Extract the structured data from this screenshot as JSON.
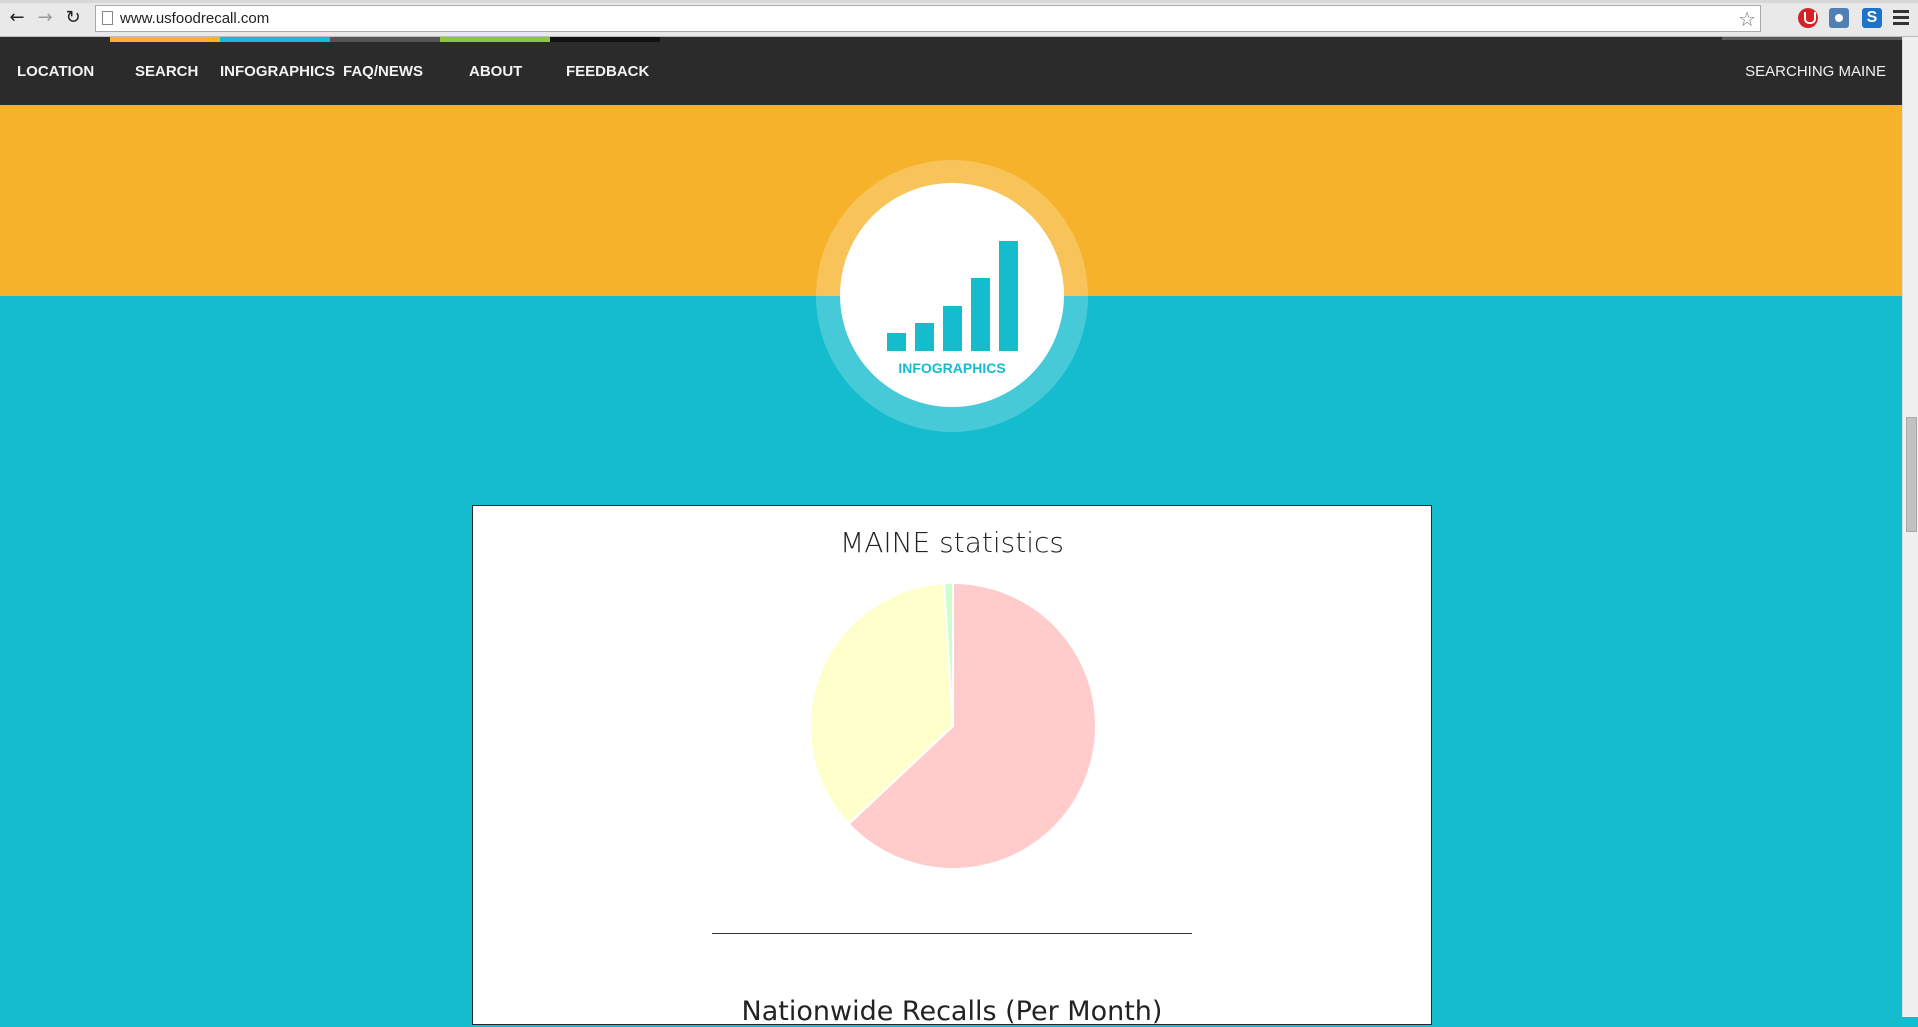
{
  "browser": {
    "url": "www.usfoodrecall.com",
    "back_icon": "back-arrow-icon",
    "forward_icon": "forward-arrow-icon",
    "reload_icon": "reload-icon"
  },
  "nav": {
    "items": [
      {
        "label": "LOCATION",
        "stripe_color": ""
      },
      {
        "label": "SEARCH",
        "stripe_color": "#f7b22b"
      },
      {
        "label": "INFOGRAPHICS",
        "stripe_color": "#14bccd"
      },
      {
        "label": "FAQ/NEWS",
        "stripe_color": "#555555"
      },
      {
        "label": "ABOUT",
        "stripe_color": "#8dc63f"
      },
      {
        "label": "FEEDBACK",
        "stripe_color": "#111111"
      }
    ],
    "status": "SEARCHING MAINE"
  },
  "colors": {
    "orange": "#f7b22b",
    "teal": "#14bccd",
    "nav_bg": "#2b2b2b"
  },
  "badge": {
    "label": "INFOGRAPHICS",
    "icon": "bar-chart-icon"
  },
  "card": {
    "title": "MAINE statistics",
    "subtitle": "Nationwide Recalls (Per Month)"
  },
  "chart_data": {
    "type": "pie",
    "title": "MAINE statistics",
    "values": [
      63,
      36,
      1
    ],
    "colors": [
      "#ffcccb",
      "#ffffcc",
      "#ccffcc"
    ]
  }
}
